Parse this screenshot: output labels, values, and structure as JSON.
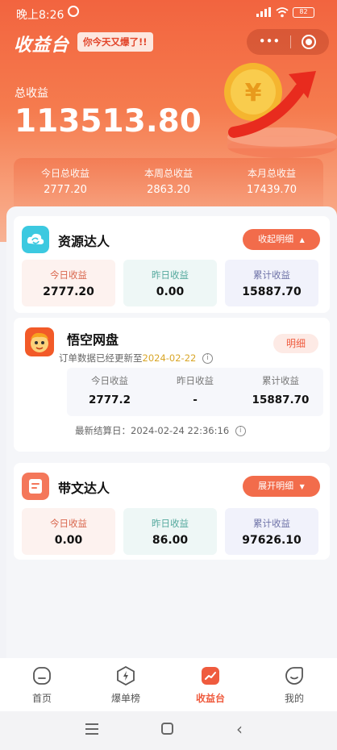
{
  "status_bar": {
    "time": "晚上8:26",
    "battery": "82"
  },
  "header": {
    "brand": "收益台",
    "slogan": "你今天又爆了!!",
    "capsule_dots": "•••"
  },
  "totals": {
    "label": "总收益",
    "value": "113513.80",
    "summary": [
      {
        "label": "今日总收益",
        "value": "2777.20"
      },
      {
        "label": "本周总收益",
        "value": "2863.20"
      },
      {
        "label": "本月总收益",
        "value": "17439.70"
      }
    ]
  },
  "cards": {
    "resource": {
      "title": "资源达人",
      "toggle": "收起明细",
      "stats": [
        {
          "label": "今日收益",
          "value": "2777.20"
        },
        {
          "label": "昨日收益",
          "value": "0.00"
        },
        {
          "label": "累计收益",
          "value": "15887.70"
        }
      ]
    },
    "wukong": {
      "title": "悟空网盘",
      "detail": "明细",
      "sub_prefix": "订单数据已经更新至",
      "sub_date": "2024-02-22",
      "stats": [
        {
          "label": "今日收益",
          "value": "2777.2"
        },
        {
          "label": "昨日收益",
          "value": "-"
        },
        {
          "label": "累计收益",
          "value": "15887.70"
        }
      ],
      "settle": "最新结算日：2024-02-24 22:36:16"
    },
    "writer": {
      "title": "带文达人",
      "toggle": "展开明细",
      "stats": [
        {
          "label": "今日收益",
          "value": "0.00"
        },
        {
          "label": "昨日收益",
          "value": "86.00"
        },
        {
          "label": "累计收益",
          "value": "97626.10"
        }
      ]
    }
  },
  "tabs": [
    {
      "label": "首页",
      "icon": "home-icon"
    },
    {
      "label": "爆单榜",
      "icon": "lightning-badge-icon"
    },
    {
      "label": "收益台",
      "icon": "chart-trend-icon",
      "active": true
    },
    {
      "label": "我的",
      "icon": "smile-icon"
    }
  ],
  "colors": {
    "accent": "#f26c4b",
    "date": "#d9a628"
  }
}
